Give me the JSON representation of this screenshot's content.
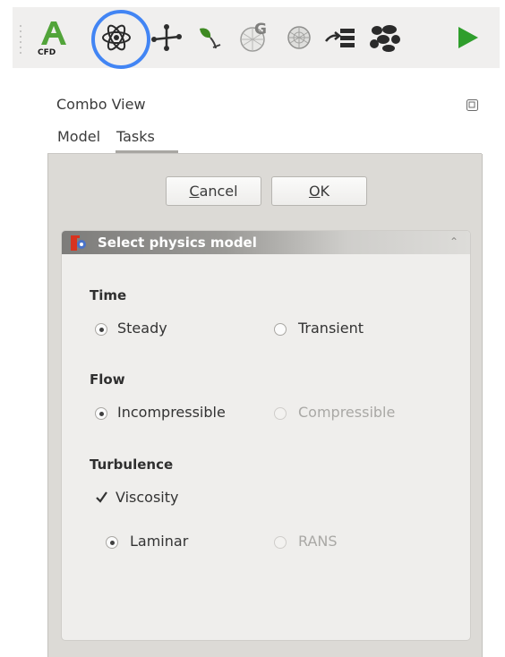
{
  "toolbar": {
    "cfd_label": "CFD",
    "icons": [
      "cfd-workbench-icon",
      "physics-model-icon",
      "fluid-properties-icon",
      "initial-conditions-icon",
      "mesh-gmsh-icon",
      "mesh-refinement-icon",
      "boundary-conditions-icon",
      "solver-icon",
      "run-solver-icon"
    ],
    "highlight_color": "#4285f4"
  },
  "combo_view": {
    "title": "Combo View",
    "tabs": [
      {
        "label": "Model",
        "selected": false
      },
      {
        "label": "Tasks",
        "selected": true
      }
    ]
  },
  "dialog": {
    "cancel_label": "Cancel",
    "ok_label": "OK"
  },
  "physics_box": {
    "title": "Select physics model",
    "time": {
      "heading": "Time",
      "options": [
        {
          "label": "Steady",
          "checked": true,
          "enabled": true
        },
        {
          "label": "Transient",
          "checked": false,
          "enabled": true
        }
      ]
    },
    "flow": {
      "heading": "Flow",
      "options": [
        {
          "label": "Incompressible",
          "checked": true,
          "enabled": true
        },
        {
          "label": "Compressible",
          "checked": false,
          "enabled": false
        }
      ]
    },
    "turbulence": {
      "heading": "Turbulence",
      "viscosity": {
        "label": "Viscosity",
        "checked": true
      },
      "options": [
        {
          "label": "Laminar",
          "checked": true,
          "enabled": true
        },
        {
          "label": "RANS",
          "checked": false,
          "enabled": false
        }
      ]
    }
  }
}
